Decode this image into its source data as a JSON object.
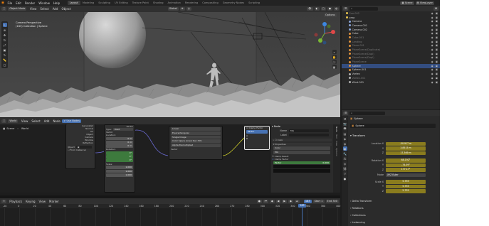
{
  "topbar": {
    "menus": [
      "File",
      "Edit",
      "Render",
      "Window",
      "Help"
    ],
    "workspaces": [
      "Layout",
      "Modeling",
      "Sculpting",
      "UV Editing",
      "Texture Paint",
      "Shading",
      "Animation",
      "Rendering",
      "Compositing",
      "Geometry Nodes",
      "Scripting"
    ],
    "active_workspace": "Layout",
    "scene_label": "Scene",
    "viewlayer_label": "ViewLayer"
  },
  "viewport": {
    "mode": "Object Mode",
    "menus": [
      "View",
      "Select",
      "Add",
      "Object"
    ],
    "orientation": "Global",
    "options": "Options",
    "info_line1": "Camera Perspective",
    "info_line2": "(183) Collection | Sphere"
  },
  "outliner": {
    "items": [
      {
        "label": "Sun.002",
        "color": "#e6c34d",
        "state": "dim"
      },
      {
        "label": "prop",
        "color": "#e6c34d",
        "state": ""
      },
      {
        "label": "Camera",
        "color": "#8aa4d6",
        "state": ""
      },
      {
        "label": "Camera.001",
        "color": "#8aa4d6",
        "state": ""
      },
      {
        "label": "Camera.002",
        "color": "#8aa4d6",
        "state": ""
      },
      {
        "label": "Cube",
        "color": "#e0923c",
        "state": ""
      },
      {
        "label": "Cube.001",
        "color": "#e0923c",
        "state": "dim"
      },
      {
        "label": "Landing",
        "color": "#e0923c",
        "state": "dim"
      },
      {
        "label": "Plane.001",
        "color": "#e0923c",
        "state": "dim"
      },
      {
        "label": "PlaneScene(Duplicate)",
        "color": "#e0923c",
        "state": "dim"
      },
      {
        "label": "PlaneScene(Dupl)",
        "color": "#e0923c",
        "state": "dim"
      },
      {
        "label": "PlaneScene(Dupl)",
        "color": "#e0923c",
        "state": "dim"
      },
      {
        "label": "PlaneScene",
        "color": "#e0923c",
        "state": "dim"
      },
      {
        "label": "Sphere",
        "color": "#e0923c",
        "state": "sel"
      },
      {
        "label": "Sphere.001",
        "color": "#e0923c",
        "state": ""
      },
      {
        "label": "Vortex",
        "color": "#b0b0b0",
        "state": ""
      },
      {
        "label": "Vortex.001",
        "color": "#b0b0b0",
        "state": "dim"
      },
      {
        "label": "Wind.001",
        "color": "#b0b0b0",
        "state": ""
      }
    ]
  },
  "node_editor": {
    "menus": [
      "View",
      "Select",
      "Add",
      "Node"
    ],
    "use_nodes": "Use Nodes",
    "world_label": "World",
    "breadcrumb_scene": "Scene",
    "breadcrumb_world": "World",
    "texcoord_outputs": [
      "Generated",
      "Normal",
      "UV",
      "Object",
      "Camera",
      "Window",
      "Reflection"
    ],
    "texcoord_object": "Object",
    "texcoord_from_instancer": "From Instancer",
    "mapping_title": "Vector",
    "mapping_type_label": "Type:",
    "mapping_type": "Point",
    "mapping_vector": "Vector",
    "mapping_location": "Location:",
    "mapping_loc_vals": [
      "0 m",
      "0 m",
      "0 m"
    ],
    "mapping_rotation": "Rotation:",
    "mapping_rot_vals": [
      "0°",
      "0°",
      "0°"
    ],
    "mapping_scale": "Scale:",
    "mapping_scale_vals": [
      "1.000",
      "1.000",
      "1.000"
    ],
    "image_node_fields": [
      "Linear",
      "Equirectangular",
      "Single Image",
      "Color Space  Linear Rec.709",
      "Alpha  Premultiplied"
    ],
    "image_node_vector": "Vector",
    "mix_clamp": "Clamp Factor",
    "mix_a": "A",
    "mix_b": "B",
    "mix_factor": "Factor"
  },
  "node_sidebar": {
    "section": "Node",
    "name_label": "Name",
    "name_value": "Mix",
    "label_label": "Label",
    "color_label": "Color",
    "properties_label": "Properties",
    "prop_color": "Color",
    "prop_mix": "Mix",
    "clamp_result": "Clamp Result",
    "clamp_factor": "Clamp Factor",
    "factor_label": "Factor",
    "factor_value": "0.000",
    "tabs": [
      "Node",
      "Tool",
      "View",
      "Options"
    ]
  },
  "properties": {
    "object_name": "Sphere",
    "breadcrumb": "Sphere",
    "transform_label": "Transform",
    "location_label": "Location X",
    "location_vals": [
      "-50.917 m",
      "3.8515 m",
      "17.369 m"
    ],
    "rotation_label": "Rotation X",
    "rotation_vals": [
      "68.192°",
      "-74.09°",
      "177.17°"
    ],
    "axis_labels": [
      "Y",
      "Z"
    ],
    "mode_label": "Mode",
    "mode_value": "XYZ Euler",
    "scale_label": "Scale X",
    "scale_vals": [
      "5.755",
      "5.755",
      "5.755"
    ],
    "sections": [
      "Delta Transform",
      "Relations",
      "Collections",
      "Instancing"
    ]
  },
  "timeline": {
    "menus": [
      "Playback",
      "Keying",
      "View",
      "Marker"
    ],
    "ticks": [
      "-20",
      "0",
      "20",
      "40",
      "60",
      "80",
      "100",
      "120",
      "140",
      "160",
      "180",
      "200",
      "220",
      "240",
      "260",
      "270",
      "280",
      "300",
      "320",
      "340",
      "360",
      "380",
      "400"
    ],
    "current_frame": "183",
    "start_label": "Start",
    "start_value": "1",
    "end_label": "End",
    "end_value": "300"
  }
}
